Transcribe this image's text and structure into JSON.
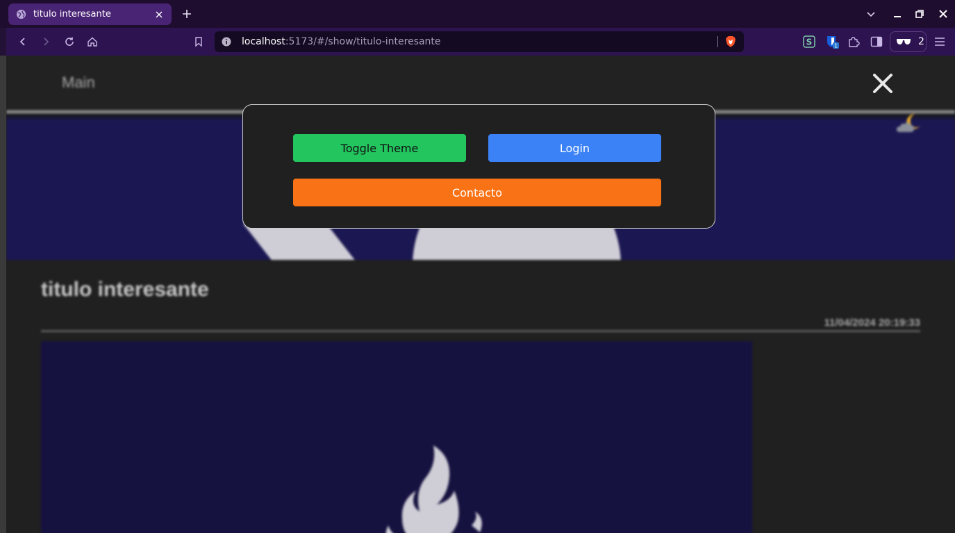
{
  "browser": {
    "tab_title": "titulo interesante",
    "url_host": "localhost",
    "url_rest": ":5173/#/show/titulo-interesante",
    "wallet_count": "2",
    "extension_badge": "1"
  },
  "site": {
    "nav_main": "Main",
    "post_title": "titulo interesante",
    "post_date": "11/04/2024 20:19:33"
  },
  "menu": {
    "toggle_theme": "Toggle Theme",
    "login": "Login",
    "contact": "Contacto"
  },
  "colors": {
    "toggle_theme": "#22c55e",
    "login": "#3b82f6",
    "contact": "#f97316",
    "tab_active": "#4a2474",
    "toolbar": "#2d1450",
    "hero_bg": "#1b1752"
  },
  "icons": [
    "globe-icon",
    "close-icon",
    "plus-icon",
    "chevron-down-icon",
    "minimize-icon",
    "restore-icon",
    "back-icon",
    "forward-icon",
    "reload-icon",
    "home-icon",
    "bookmark-icon",
    "info-icon",
    "brave-shield-icon",
    "menu-icon",
    "moon-cloud-icon",
    "flame-icon"
  ]
}
